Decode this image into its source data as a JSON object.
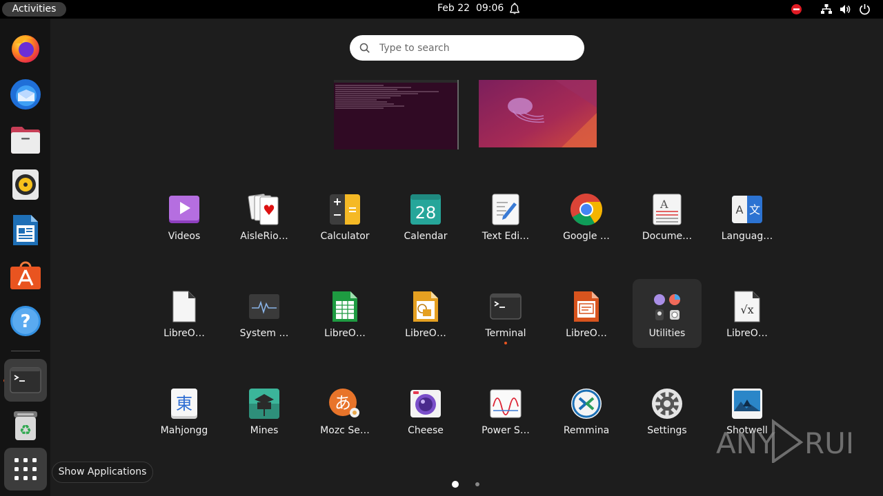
{
  "topbar": {
    "activities": "Activities",
    "clock": "Feb 22  09:06"
  },
  "search": {
    "placeholder": "Type to search"
  },
  "dock": {
    "items": [
      {
        "name": "firefox-icon"
      },
      {
        "name": "thunderbird-icon"
      },
      {
        "name": "files-icon"
      },
      {
        "name": "rhythmbox-icon"
      },
      {
        "name": "libreoffice-writer-icon"
      },
      {
        "name": "ubuntu-software-icon"
      },
      {
        "name": "help-icon"
      },
      {
        "name": "terminal-icon"
      },
      {
        "name": "trash-icon"
      },
      {
        "name": "show-applications-icon"
      }
    ]
  },
  "tooltip": "Show Applications",
  "apps": [
    {
      "label": "Videos"
    },
    {
      "label": "AisleRio…"
    },
    {
      "label": "Calculator"
    },
    {
      "label": "Calendar",
      "icon_text": "28"
    },
    {
      "label": "Text Edi…"
    },
    {
      "label": "Google …"
    },
    {
      "label": "Docume…"
    },
    {
      "label": "Languag…",
      "icon_text_a": "A",
      "icon_text_b": "文"
    },
    {
      "label": "LibreO…"
    },
    {
      "label": "System …"
    },
    {
      "label": "LibreO…"
    },
    {
      "label": "LibreO…"
    },
    {
      "label": "Terminal"
    },
    {
      "label": "LibreO…"
    },
    {
      "label": "Utilities"
    },
    {
      "label": "LibreO…"
    },
    {
      "label": "Mahjongg",
      "icon_text": "東"
    },
    {
      "label": "Mines"
    },
    {
      "label": "Mozc Se…",
      "icon_text": "あ"
    },
    {
      "label": "Cheese"
    },
    {
      "label": "Power S…"
    },
    {
      "label": "Remmina"
    },
    {
      "label": "Settings"
    },
    {
      "label": "Shotwell"
    }
  ],
  "watermark": {
    "text_a": "ANY",
    "text_b": "RUN"
  },
  "colors": {
    "accent": "#e95420",
    "background": "#1d1d1d",
    "topbar": "#000000"
  }
}
